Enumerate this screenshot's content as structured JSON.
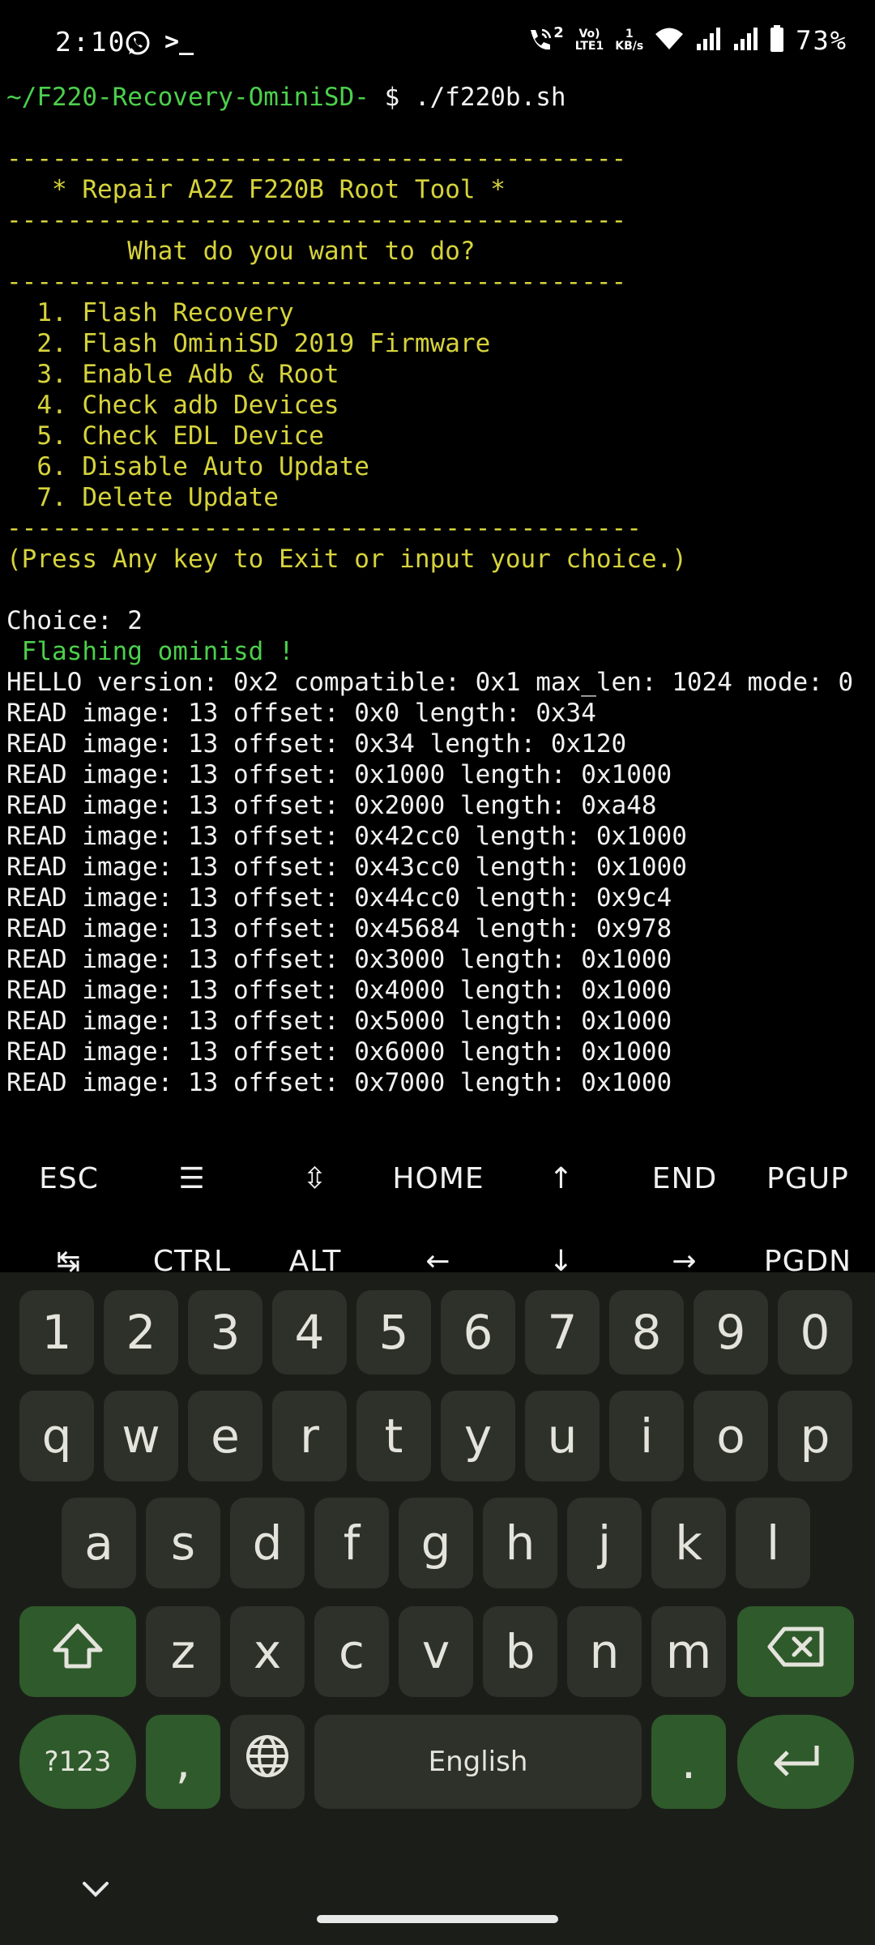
{
  "status_bar": {
    "time": "2:10",
    "network_speed_value": "1",
    "network_speed_unit": "KB/s",
    "volte_top": "Vo)",
    "volte_bottom": "LTE1",
    "call_badge": "2",
    "battery": "73%"
  },
  "terminal": {
    "lines": [
      {
        "text": "~/F220-Recovery-OminiSD- ",
        "color": "green",
        "suffix": "$ ./f220b.sh"
      },
      {
        "text": "",
        "color": "white"
      },
      {
        "text": "-----------------------------------------",
        "color": "yellow"
      },
      {
        "text": "   * Repair A2Z F220B Root Tool *",
        "color": "yellow"
      },
      {
        "text": "-----------------------------------------",
        "color": "yellow"
      },
      {
        "text": "        What do you want to do?",
        "color": "yellow"
      },
      {
        "text": "-----------------------------------------",
        "color": "yellow"
      },
      {
        "text": "  1. Flash Recovery",
        "color": "yellow"
      },
      {
        "text": "  2. Flash OminiSD 2019 Firmware",
        "color": "yellow"
      },
      {
        "text": "  3. Enable Adb & Root",
        "color": "yellow"
      },
      {
        "text": "  4. Check adb Devices",
        "color": "yellow"
      },
      {
        "text": "  5. Check EDL Device",
        "color": "yellow"
      },
      {
        "text": "  6. Disable Auto Update",
        "color": "yellow"
      },
      {
        "text": "  7. Delete Update",
        "color": "yellow"
      },
      {
        "text": "------------------------------------------",
        "color": "yellow"
      },
      {
        "text": "(Press Any key to Exit or input your choice.)",
        "color": "yellow"
      },
      {
        "text": "",
        "color": "white"
      },
      {
        "text": "Choice: 2",
        "color": "white"
      },
      {
        "text": " Flashing ominisd !",
        "color": "green"
      },
      {
        "text": "HELLO version: 0x2 compatible: 0x1 max_len: 1024 mode: 0",
        "color": "white"
      },
      {
        "text": "READ image: 13 offset: 0x0 length: 0x34",
        "color": "white"
      },
      {
        "text": "READ image: 13 offset: 0x34 length: 0x120",
        "color": "white"
      },
      {
        "text": "READ image: 13 offset: 0x1000 length: 0x1000",
        "color": "white"
      },
      {
        "text": "READ image: 13 offset: 0x2000 length: 0xa48",
        "color": "white"
      },
      {
        "text": "READ image: 13 offset: 0x42cc0 length: 0x1000",
        "color": "white"
      },
      {
        "text": "READ image: 13 offset: 0x43cc0 length: 0x1000",
        "color": "white"
      },
      {
        "text": "READ image: 13 offset: 0x44cc0 length: 0x9c4",
        "color": "white"
      },
      {
        "text": "READ image: 13 offset: 0x45684 length: 0x978",
        "color": "white"
      },
      {
        "text": "READ image: 13 offset: 0x3000 length: 0x1000",
        "color": "white"
      },
      {
        "text": "READ image: 13 offset: 0x4000 length: 0x1000",
        "color": "white"
      },
      {
        "text": "READ image: 13 offset: 0x5000 length: 0x1000",
        "color": "white"
      },
      {
        "text": "READ image: 13 offset: 0x6000 length: 0x1000",
        "color": "white"
      },
      {
        "text": "READ image: 13 offset: 0x7000 length: 0x1000",
        "color": "white"
      }
    ]
  },
  "extra_keys": {
    "row1": [
      "ESC",
      "☰",
      "⇳",
      "HOME",
      "↑",
      "END",
      "PGUP"
    ],
    "row2": [
      "↹",
      "CTRL",
      "ALT",
      "←",
      "↓",
      "→",
      "PGDN"
    ]
  },
  "keyboard": {
    "numbers": [
      "1",
      "2",
      "3",
      "4",
      "5",
      "6",
      "7",
      "8",
      "9",
      "0"
    ],
    "row_q": [
      "q",
      "w",
      "e",
      "r",
      "t",
      "y",
      "u",
      "i",
      "o",
      "p"
    ],
    "row_a": [
      "a",
      "s",
      "d",
      "f",
      "g",
      "h",
      "j",
      "k",
      "l"
    ],
    "row_z": [
      "z",
      "x",
      "c",
      "v",
      "b",
      "n",
      "m"
    ],
    "symbols_label": "?123",
    "comma": ",",
    "space_label": "English",
    "period": "."
  }
}
